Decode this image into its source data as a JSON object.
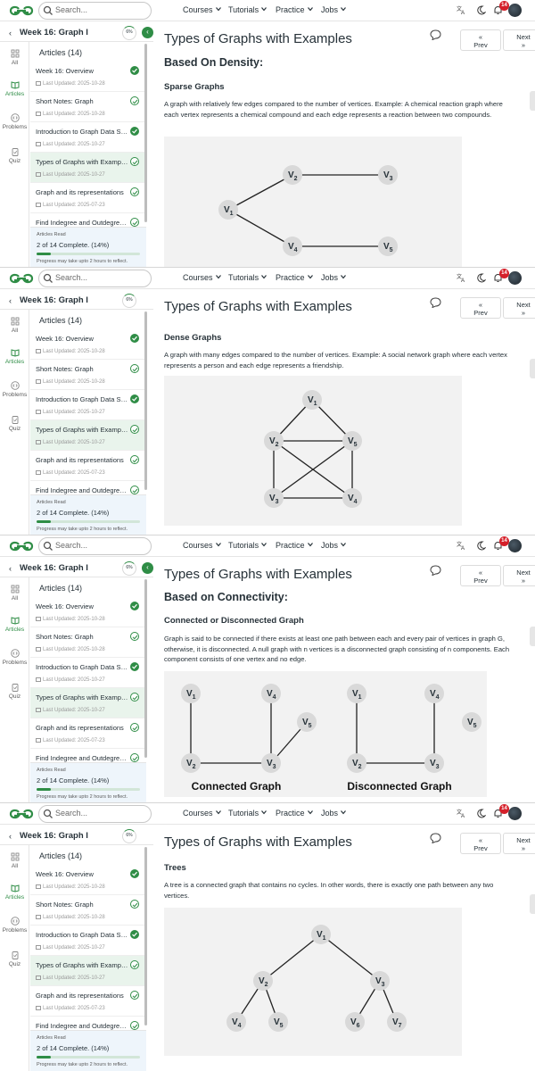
{
  "header": {
    "search_placeholder": "Search...",
    "nav": [
      "Courses",
      "Tutorials",
      "Practice",
      "Jobs"
    ],
    "notification_count": "14"
  },
  "sidebar": {
    "back_label": "Week 16: Graph I",
    "progress_ring": "6%",
    "rail": [
      {
        "label": "All",
        "icon": "grid-icon"
      },
      {
        "label": "Articles",
        "icon": "book-icon"
      },
      {
        "label": "Problems",
        "icon": "code-icon"
      },
      {
        "label": "Quiz",
        "icon": "clipboard-icon"
      }
    ],
    "articles_header": "Articles (14)",
    "articles": [
      {
        "title": "Week 16: Overview",
        "updated": "Last Updated: 2025-10-28",
        "status": "complete"
      },
      {
        "title": "Short Notes: Graph",
        "updated": "Last Updated: 2025-10-28",
        "status": "ring"
      },
      {
        "title": "Introduction to Graph Data Str...",
        "updated": "Last Updated: 2025-10-27",
        "status": "complete"
      },
      {
        "title": "Types of Graphs with Examples",
        "updated": "Last Updated: 2025-10-27",
        "status": "ring",
        "current": true
      },
      {
        "title": "Graph and its representations",
        "updated": "Last Updated: 2025-07-23",
        "status": "ring"
      },
      {
        "title": "Find Indegree and Outdegree ...",
        "updated": "",
        "status": "ring"
      }
    ],
    "progress": {
      "label": "Articles Read",
      "value": "2 of 14 Complete. (14%)",
      "fraction": 0.14,
      "note": "Progress may take upto 2 hours to reflect."
    }
  },
  "page": {
    "title": "Types of Graphs with Examples",
    "prev_arrow": "«",
    "prev_label": "Prev",
    "next_label": "Next",
    "next_arrow": "»"
  },
  "sections": [
    {
      "heading": "Based On Density:",
      "subheading": "Sparse Graphs",
      "text": "A graph with relatively few edges compared to the number of vertices. Example: A chemical reaction graph where each vertex represents a chemical compound and each edge represents a reaction between two compounds."
    },
    {
      "heading": "",
      "subheading": "Dense Graphs",
      "text": "A graph with many edges compared to the number of vertices. Example: A social network graph where each vertex represents a person and each edge represents a friendship."
    },
    {
      "heading": "Based on Connectivity:",
      "subheading": "Connected or Disconnected Graph",
      "text": "Graph is said to be connected if there exists at least one path between each and every pair of vertices in graph G, otherwise, it is disconnected. A null graph with n vertices is a disconnected graph consisting of n components. Each component consists of one vertex and no edge.",
      "captions": [
        "Connected Graph",
        "Disconnected Graph"
      ]
    },
    {
      "heading": "",
      "subheading": "Trees",
      "text": "A tree is a connected graph that contains no cycles. In other words, there is exactly one path between any two vertices."
    }
  ],
  "vertex_letter": "V",
  "colors": {
    "brand_green": "#2f8d46",
    "node_fill": "#d9d9d9",
    "figure_bg": "#f2f2f2",
    "badge_red": "#d5202a"
  }
}
